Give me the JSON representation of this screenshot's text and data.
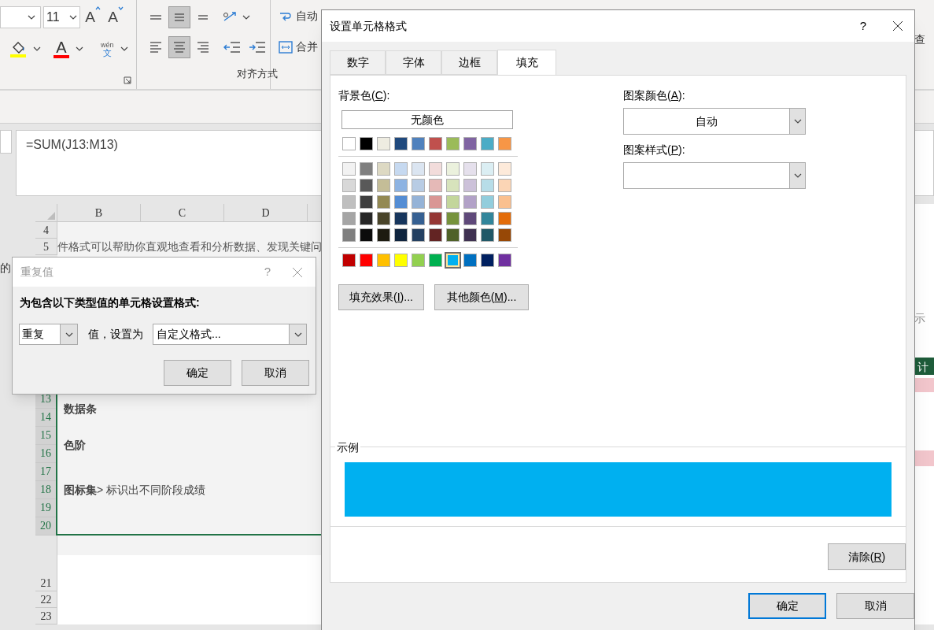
{
  "ribbon": {
    "font_size": "11",
    "size_buttons": [
      {
        "kind": "grow",
        "glyph": "A"
      },
      {
        "kind": "shrink",
        "glyph": "A"
      }
    ],
    "font_color_glyph": "A",
    "phonetic": {
      "top": "wén",
      "bottom": "文"
    },
    "align_vertical": [
      {
        "kind": "top",
        "selected": false
      },
      {
        "kind": "middle",
        "selected": true
      },
      {
        "kind": "bottom",
        "selected": false
      }
    ],
    "align_horizontal": [
      {
        "kind": "left",
        "selected": false
      },
      {
        "kind": "center",
        "selected": true
      },
      {
        "kind": "right",
        "selected": false
      }
    ],
    "wrap_label": "自动",
    "merge_label": "合并",
    "group_label": "对齐方式",
    "right_fragment": "查"
  },
  "formula": "=SUM(J13:M13)",
  "sheet": {
    "columns": [
      "B",
      "C",
      "D"
    ],
    "left_fragment": "的",
    "top_rows": [
      {
        "number": "4",
        "text": ""
      },
      {
        "number": "5",
        "text": "件格式可以帮助你直观地查看和分析数据、发现关键问"
      }
    ],
    "rows": [
      {
        "number": "13",
        "selected": true
      },
      {
        "number": "14",
        "selected": true
      },
      {
        "number": "15",
        "selected": true
      },
      {
        "number": "16",
        "selected": true
      },
      {
        "number": "17",
        "selected": true
      },
      {
        "number": "18",
        "selected": true
      },
      {
        "number": "19",
        "selected": true
      },
      {
        "number": "20",
        "selected": true
      }
    ],
    "blocks": [
      {
        "text": "数据条"
      },
      {
        "text": "色阶"
      },
      {
        "text": "**图标集**> 标识出不同阶段成绩"
      }
    ],
    "bottom_rows": [
      "21",
      "22",
      "23"
    ],
    "right_fragments": [
      {
        "kind": "plain",
        "text": "示"
      },
      {
        "kind": "header",
        "text": "计"
      }
    ]
  },
  "dup_dialog": {
    "title": "重复值",
    "help": "?",
    "prompt": "为包含以下类型值的单元格设置格式:",
    "type_value": "重复",
    "middle_text": "值，设置为",
    "format_value": "自定义格式...",
    "buttons": [
      "确定",
      "取消"
    ]
  },
  "format_dialog": {
    "title": "设置单元格格式",
    "help": "?",
    "tabs": [
      {
        "label": "数字",
        "selected": false
      },
      {
        "label": "字体",
        "selected": false
      },
      {
        "label": "边框",
        "selected": false
      },
      {
        "label": "填充",
        "selected": true
      }
    ],
    "background_label": {
      "before": "背景色(",
      "accel": "C",
      "after": "):"
    },
    "no_color": "无颜色",
    "theme_colors": [
      {
        "color": "#ffffff",
        "selected": false
      },
      {
        "color": "#000000",
        "selected": false
      },
      {
        "color": "#eeece1",
        "selected": false
      },
      {
        "color": "#1f497d",
        "selected": false
      },
      {
        "color": "#4f81bd",
        "selected": false
      },
      {
        "color": "#c0504d",
        "selected": false
      },
      {
        "color": "#9bbb59",
        "selected": false
      },
      {
        "color": "#8064a2",
        "selected": false
      },
      {
        "color": "#4bacc6",
        "selected": false
      },
      {
        "color": "#f79646",
        "selected": false
      }
    ],
    "shade_rows": [
      [
        {
          "color": "#f2f2f2",
          "selected": false
        },
        {
          "color": "#7f7f7f",
          "selected": false
        },
        {
          "color": "#ddd9c3",
          "selected": false
        },
        {
          "color": "#c6d9f0",
          "selected": false
        },
        {
          "color": "#dbe5f1",
          "selected": false
        },
        {
          "color": "#f2dcdb",
          "selected": false
        },
        {
          "color": "#ebf1dd",
          "selected": false
        },
        {
          "color": "#e5e0ec",
          "selected": false
        },
        {
          "color": "#dbeef3",
          "selected": false
        },
        {
          "color": "#fdeada",
          "selected": false
        }
      ],
      [
        {
          "color": "#d8d8d8",
          "selected": false
        },
        {
          "color": "#595959",
          "selected": false
        },
        {
          "color": "#c4bd97",
          "selected": false
        },
        {
          "color": "#8db3e2",
          "selected": false
        },
        {
          "color": "#b8cce4",
          "selected": false
        },
        {
          "color": "#e5b9b7",
          "selected": false
        },
        {
          "color": "#d7e3bc",
          "selected": false
        },
        {
          "color": "#ccc1d9",
          "selected": false
        },
        {
          "color": "#b7dde8",
          "selected": false
        },
        {
          "color": "#fbd5b5",
          "selected": false
        }
      ],
      [
        {
          "color": "#bfbfbf",
          "selected": false
        },
        {
          "color": "#3f3f3f",
          "selected": false
        },
        {
          "color": "#938953",
          "selected": false
        },
        {
          "color": "#548dd4",
          "selected": false
        },
        {
          "color": "#95b3d7",
          "selected": false
        },
        {
          "color": "#d99694",
          "selected": false
        },
        {
          "color": "#c3d69b",
          "selected": false
        },
        {
          "color": "#b2a2c7",
          "selected": false
        },
        {
          "color": "#92cddc",
          "selected": false
        },
        {
          "color": "#fac08f",
          "selected": false
        }
      ],
      [
        {
          "color": "#a5a5a5",
          "selected": false
        },
        {
          "color": "#262626",
          "selected": false
        },
        {
          "color": "#494429",
          "selected": false
        },
        {
          "color": "#17365d",
          "selected": false
        },
        {
          "color": "#366092",
          "selected": false
        },
        {
          "color": "#953734",
          "selected": false
        },
        {
          "color": "#76923c",
          "selected": false
        },
        {
          "color": "#5f497a",
          "selected": false
        },
        {
          "color": "#31859b",
          "selected": false
        },
        {
          "color": "#e36c09",
          "selected": false
        }
      ],
      [
        {
          "color": "#7f7f7f",
          "selected": false
        },
        {
          "color": "#0c0c0c",
          "selected": false
        },
        {
          "color": "#1d1b10",
          "selected": false
        },
        {
          "color": "#0f243e",
          "selected": false
        },
        {
          "color": "#244061",
          "selected": false
        },
        {
          "color": "#632423",
          "selected": false
        },
        {
          "color": "#4f6128",
          "selected": false
        },
        {
          "color": "#3f3151",
          "selected": false
        },
        {
          "color": "#205867",
          "selected": false
        },
        {
          "color": "#974806",
          "selected": false
        }
      ]
    ],
    "standard_colors": [
      {
        "color": "#c00000",
        "selected": false
      },
      {
        "color": "#ff0000",
        "selected": false
      },
      {
        "color": "#ffc000",
        "selected": false
      },
      {
        "color": "#ffff00",
        "selected": false
      },
      {
        "color": "#92d050",
        "selected": false
      },
      {
        "color": "#00b050",
        "selected": false
      },
      {
        "color": "#00b0f0",
        "selected": true
      },
      {
        "color": "#0070c0",
        "selected": false
      },
      {
        "color": "#002060",
        "selected": false
      },
      {
        "color": "#7030a0",
        "selected": false
      }
    ],
    "effect_buttons": [
      {
        "before": "填充效果(",
        "accel": "I",
        "after": ")..."
      },
      {
        "before": "其他颜色(",
        "accel": "M",
        "after": ")..."
      }
    ],
    "pattern_color_label": {
      "before": "图案颜色(",
      "accel": "A",
      "after": "):"
    },
    "pattern_color_value": "自动",
    "pattern_style_label": {
      "before": "图案样式(",
      "accel": "P",
      "after": "):"
    },
    "sample_label": "示例",
    "clear_button": {
      "before": "清除(",
      "accel": "R",
      "after": ")"
    },
    "buttons": [
      "确定",
      "取消"
    ]
  }
}
